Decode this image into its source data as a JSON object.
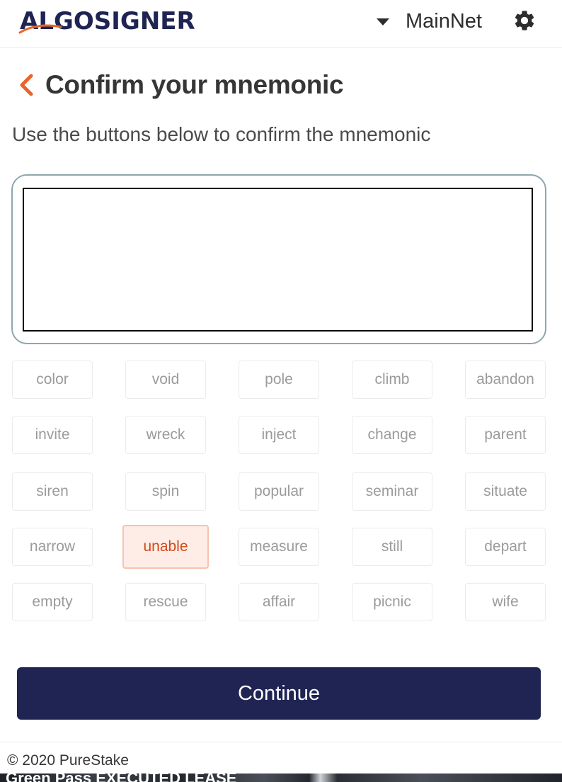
{
  "header": {
    "logo_text": "ALGOSIGNER",
    "network_label": "MainNet",
    "network_icon": "caret-down-icon",
    "settings_icon": "gear-icon",
    "accent_color": "#e9652a",
    "brand_color": "#1f2453"
  },
  "page": {
    "back_icon": "chevron-left-icon",
    "title": "Confirm your mnemonic",
    "subtitle": "Use the buttons below to confirm the mnemonic",
    "mnemonic_value": ""
  },
  "words": [
    {
      "label": "color",
      "selected": false
    },
    {
      "label": "void",
      "selected": false
    },
    {
      "label": "pole",
      "selected": false
    },
    {
      "label": "climb",
      "selected": false
    },
    {
      "label": "abandon",
      "selected": false
    },
    {
      "label": "invite",
      "selected": false
    },
    {
      "label": "wreck",
      "selected": false
    },
    {
      "label": "inject",
      "selected": false
    },
    {
      "label": "change",
      "selected": false
    },
    {
      "label": "parent",
      "selected": false
    },
    {
      "label": "siren",
      "selected": false
    },
    {
      "label": "spin",
      "selected": false
    },
    {
      "label": "popular",
      "selected": false
    },
    {
      "label": "seminar",
      "selected": false
    },
    {
      "label": "situate",
      "selected": false
    },
    {
      "label": "narrow",
      "selected": false
    },
    {
      "label": "unable",
      "selected": true
    },
    {
      "label": "measure",
      "selected": false
    },
    {
      "label": "still",
      "selected": false
    },
    {
      "label": "depart",
      "selected": false
    },
    {
      "label": "empty",
      "selected": false
    },
    {
      "label": "rescue",
      "selected": false
    },
    {
      "label": "affair",
      "selected": false
    },
    {
      "label": "picnic",
      "selected": false
    },
    {
      "label": "wife",
      "selected": false
    }
  ],
  "actions": {
    "continue_label": "Continue"
  },
  "footer": {
    "copyright": "© 2020 PureStake",
    "ticker_text": "Green Pass  EXECUTED LEASE"
  }
}
